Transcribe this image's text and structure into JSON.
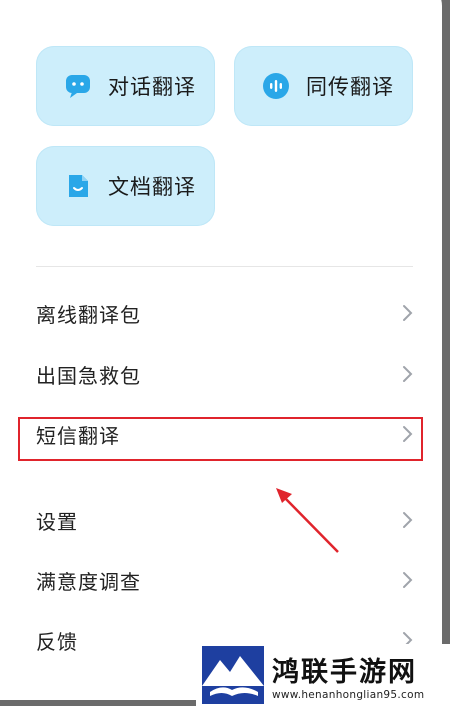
{
  "tiles": [
    {
      "label": "对话翻译",
      "icon": "chat-bubble-icon"
    },
    {
      "label": "同传翻译",
      "icon": "voice-wave-icon"
    },
    {
      "label": "文档翻译",
      "icon": "document-icon"
    }
  ],
  "menu": [
    {
      "label": "离线翻译包"
    },
    {
      "label": "出国急救包"
    },
    {
      "label": "短信翻译"
    },
    {
      "label": "设置"
    },
    {
      "label": "满意度调查"
    },
    {
      "label": "反馈"
    }
  ],
  "highlighted_item": "短信翻译",
  "annotation": {
    "arrow_color": "#e0242c",
    "box_color": "#e0242c"
  },
  "watermark": {
    "title": "鸿联手游网",
    "url": "www.henanhonglian95.com"
  },
  "colors": {
    "tile_bg": "#cdeefb",
    "icon_blue": "#2aa7e8",
    "panel_bg": "#ffffff",
    "backdrop": "#6b6b6b"
  }
}
